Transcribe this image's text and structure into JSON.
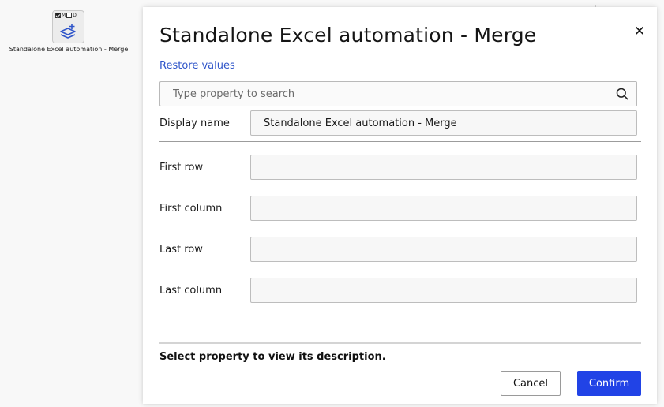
{
  "canvas": {
    "node": {
      "flag_m": "M",
      "flag_d": "D",
      "label": "Standalone Excel automation - Merge",
      "icon": "layers-plus-icon"
    }
  },
  "dialog": {
    "title": "Standalone Excel automation - Merge",
    "close_icon": "close-icon",
    "restore_label": "Restore values",
    "search": {
      "placeholder": "Type property to search",
      "value": "",
      "icon": "search-icon"
    },
    "display_name": {
      "label": "Display name",
      "value": "Standalone Excel automation - Merge"
    },
    "properties": [
      {
        "label": "First row",
        "value": ""
      },
      {
        "label": "First column",
        "value": ""
      },
      {
        "label": "Last row",
        "value": ""
      },
      {
        "label": "Last column",
        "value": ""
      }
    ],
    "description": "Select property to view its description.",
    "cancel_label": "Cancel",
    "confirm_label": "Confirm"
  },
  "colors": {
    "accent": "#2143e6",
    "link": "#2f55c9"
  }
}
